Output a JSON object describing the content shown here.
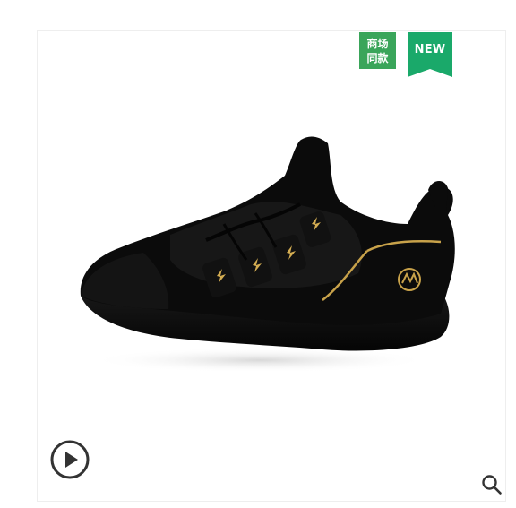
{
  "badges": {
    "store_line1": "商场",
    "store_line2": "同款",
    "new_label": "NEW"
  },
  "colors": {
    "store_badge": "#3aa55a",
    "new_badge": "#1aa96a",
    "icon": "#333333"
  },
  "icons": {
    "play": "play-icon",
    "zoom": "magnifier-icon"
  }
}
